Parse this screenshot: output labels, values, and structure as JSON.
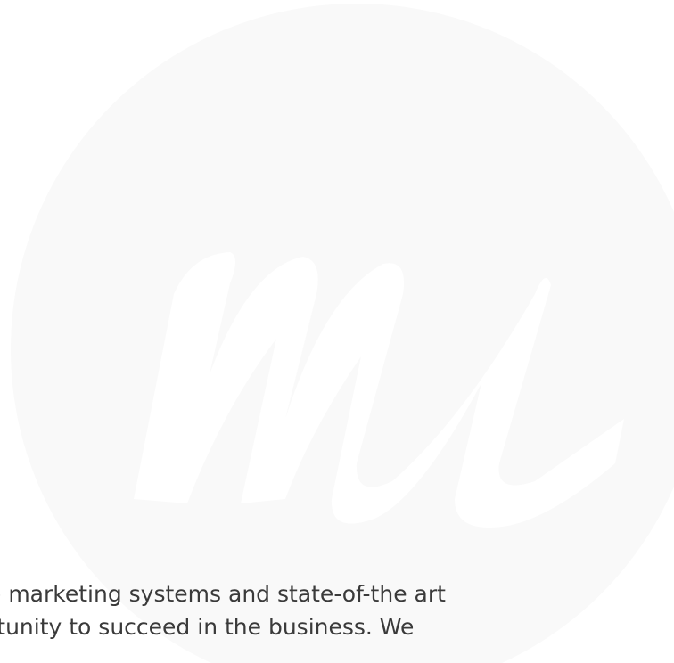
{
  "watermark": {
    "icon": "brand-logo-watermark",
    "circle_color": "#f9f9f9",
    "letter_color": "#ffffff"
  },
  "content": {
    "line_1": "e marketing systems and state-of-the art",
    "line_2": "rtunity to succeed in the business. We"
  }
}
